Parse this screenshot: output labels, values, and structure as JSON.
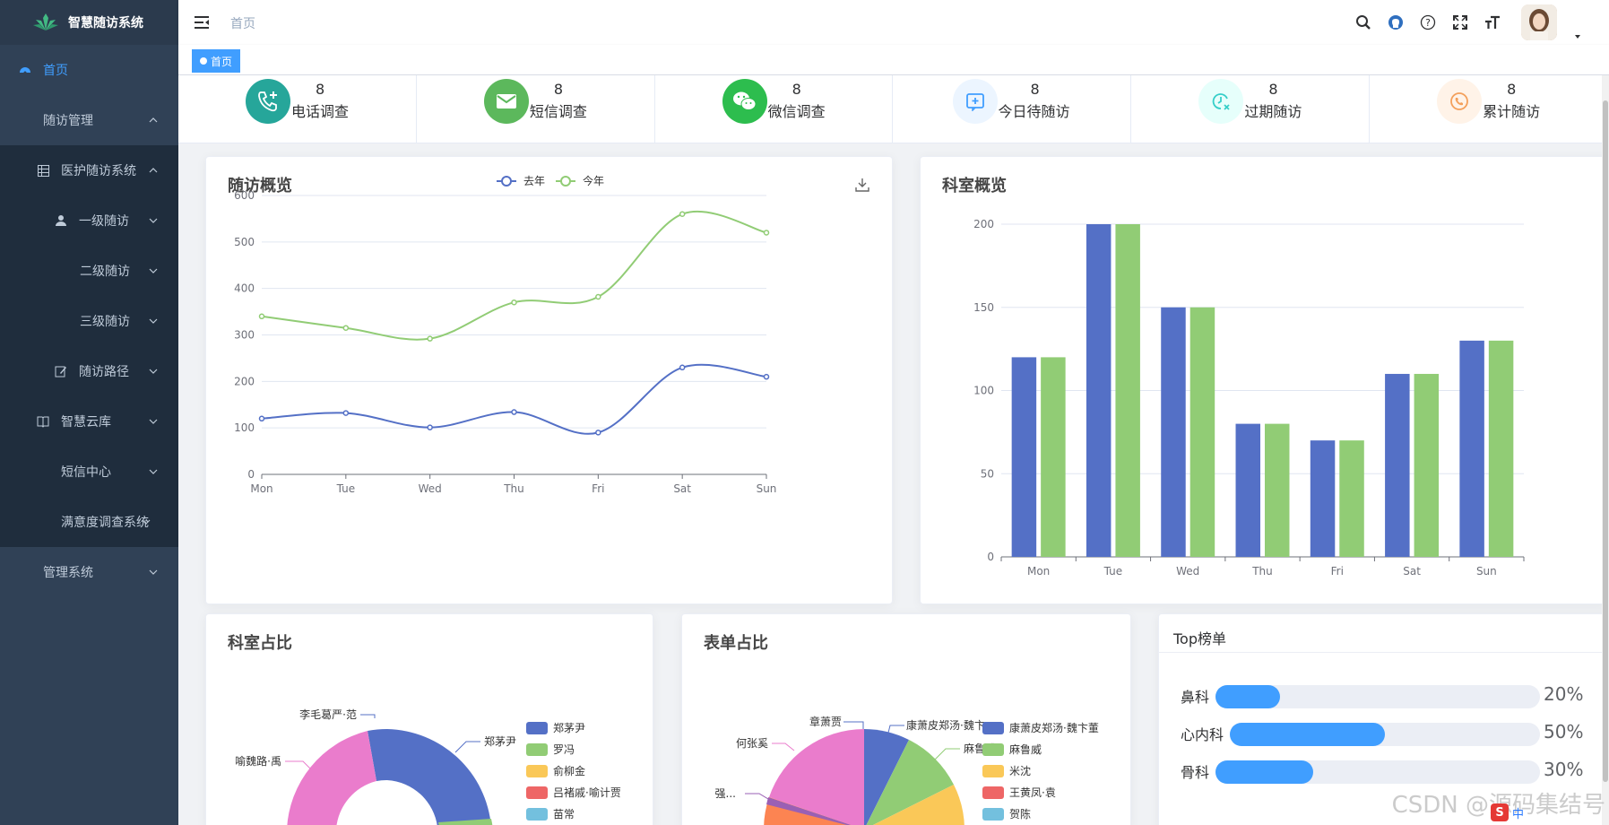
{
  "app": {
    "title": "智慧随访系统"
  },
  "sidebar": {
    "items": [
      {
        "label": "首页",
        "icon": "dashboard-icon",
        "active": true
      },
      {
        "label": "随访管理",
        "icon": "",
        "expanded": true
      },
      {
        "label": "医护随访系统",
        "icon": "table-icon",
        "expanded": true
      },
      {
        "label": "一级随访",
        "icon": "user-icon"
      },
      {
        "label": "二级随访",
        "icon": ""
      },
      {
        "label": "三级随访",
        "icon": ""
      },
      {
        "label": "随访路径",
        "icon": "edit-icon"
      },
      {
        "label": "智慧云库",
        "icon": "book-icon"
      },
      {
        "label": "短信中心",
        "icon": ""
      },
      {
        "label": "满意度调查系统",
        "icon": ""
      },
      {
        "label": "管理系统",
        "icon": ""
      }
    ]
  },
  "header": {
    "breadcrumb": "首页",
    "icons": [
      "search-icon",
      "github-icon",
      "question-icon",
      "fullscreen-icon",
      "font-size-icon"
    ]
  },
  "tags": [
    {
      "label": "首页",
      "active": true
    }
  ],
  "stats": [
    {
      "value": "8",
      "label": "电话调查",
      "icon": "phone-icon",
      "color": "#26a69a"
    },
    {
      "value": "8",
      "label": "短信调查",
      "icon": "mail-icon",
      "color": "#5cb85c"
    },
    {
      "value": "8",
      "label": "微信调查",
      "icon": "wechat-icon",
      "color": "#2dbd4e"
    },
    {
      "value": "8",
      "label": "今日待随访",
      "icon": "calendar-plus-icon",
      "color": "#409eff"
    },
    {
      "value": "8",
      "label": "过期随访",
      "icon": "clock-icon",
      "color": "#36cfc9"
    },
    {
      "value": "8",
      "label": "累计随访",
      "icon": "phone-circle-icon",
      "color": "#f4a05b"
    }
  ],
  "cards": {
    "line_title": "随访概览",
    "bar_title": "科室概览",
    "pie1_title": "科室占比",
    "pie2_title": "表单占比",
    "top_title": "Top榜单"
  },
  "chart_data": [
    {
      "type": "line",
      "title": "随访概览",
      "categories": [
        "Mon",
        "Tue",
        "Wed",
        "Thu",
        "Fri",
        "Sat",
        "Sun"
      ],
      "series": [
        {
          "name": "去年",
          "color": "#5470c6",
          "values": [
            120,
            132,
            101,
            134,
            90,
            230,
            210
          ]
        },
        {
          "name": "今年",
          "color": "#91cc75",
          "values": [
            340,
            315,
            292,
            370,
            382,
            560,
            520
          ]
        }
      ],
      "ylim": [
        0,
        600
      ],
      "yticks": [
        0,
        100,
        200,
        300,
        400,
        500,
        600
      ],
      "legend": "top-center",
      "grid": true
    },
    {
      "type": "bar",
      "title": "科室概览",
      "categories": [
        "Mon",
        "Tue",
        "Wed",
        "Thu",
        "Fri",
        "Sat",
        "Sun"
      ],
      "series": [
        {
          "color": "#5470c6",
          "values": [
            120,
            200,
            150,
            80,
            70,
            110,
            130
          ]
        },
        {
          "color": "#91cc75",
          "values": [
            120,
            200,
            150,
            80,
            70,
            110,
            130
          ]
        }
      ],
      "ylim": [
        0,
        200
      ],
      "yticks": [
        0,
        50,
        100,
        150,
        200
      ],
      "grid": true
    },
    {
      "type": "pie",
      "title": "科室占比",
      "legend": [
        "郑茅尹",
        "罗冯",
        "俞柳金",
        "吕褚戚·喻计贾",
        "苗常"
      ],
      "legend_colors": [
        "#5470c6",
        "#91cc75",
        "#fac858",
        "#ee6666",
        "#73c0de"
      ],
      "visible_labels": [
        "李毛葛严·范",
        "喻魏路·禹",
        "郑茅尹"
      ]
    },
    {
      "type": "pie",
      "title": "表单占比",
      "legend": [
        "康萧皮郑汤·魏卞董",
        "麻鲁威",
        "米沈",
        "王黄凤·袁",
        "贺陈"
      ],
      "legend_colors": [
        "#5470c6",
        "#91cc75",
        "#fac858",
        "#ee6666",
        "#73c0de"
      ],
      "visible_labels": [
        "章萧贾",
        "康萧皮郑汤·魏卞",
        "麻鲁威",
        "何张奚",
        "强..."
      ]
    }
  ],
  "top_list": [
    {
      "label": "鼻科",
      "percent": 20,
      "text": "20%"
    },
    {
      "label": "心内科",
      "percent": 50,
      "text": "50%"
    },
    {
      "label": "骨科",
      "percent": 30,
      "text": "30%"
    }
  ],
  "watermark": "CSDN @源码集结号",
  "ime": {
    "s_label": "S",
    "lang": "中"
  }
}
